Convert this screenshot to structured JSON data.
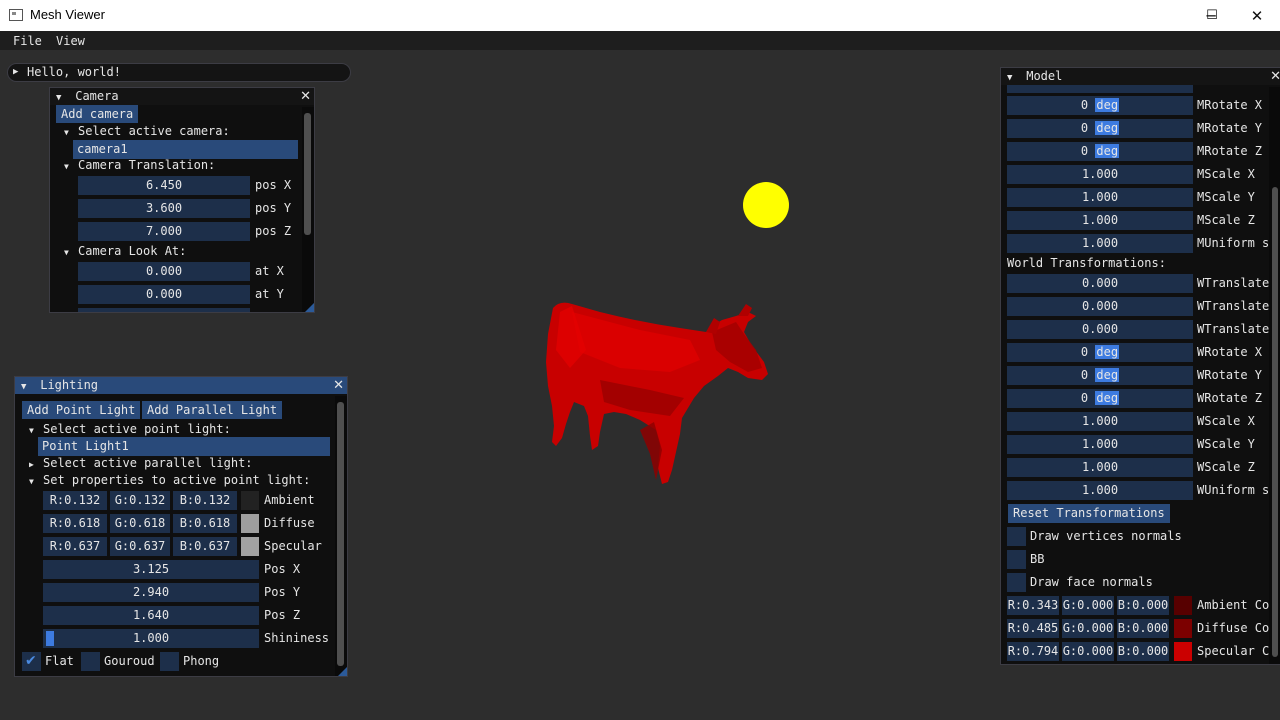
{
  "window": {
    "title": "Mesh Viewer",
    "minimize_glyph": "─",
    "maximize_glyph": "☐",
    "close_glyph": "✕"
  },
  "menu": {
    "file": "File",
    "view": "View"
  },
  "hello": {
    "label": "Hello, world!"
  },
  "camera": {
    "title": "Camera",
    "add_button": "Add camera",
    "select_label": "Select active camera:",
    "active_camera": "camera1",
    "translation_label": "Camera Translation:",
    "translation": [
      {
        "value": "6.450",
        "label": "pos X"
      },
      {
        "value": "3.600",
        "label": "pos Y"
      },
      {
        "value": "7.000",
        "label": "pos Z"
      }
    ],
    "lookat_label": "Camera Look At:",
    "lookat": [
      {
        "value": "0.000",
        "label": "at X"
      },
      {
        "value": "0.000",
        "label": "at Y"
      }
    ]
  },
  "lighting": {
    "title": "Lighting",
    "add_point": "Add Point Light",
    "add_parallel": "Add Parallel Light",
    "select_point_label": "Select active point light:",
    "active_point_light": "Point Light1",
    "select_parallel_label": "Select active parallel light:",
    "set_props_label": "Set properties to active point light:",
    "colors": [
      {
        "r": "R:0.132",
        "g": "G:0.132",
        "b": "B:0.132",
        "label": "Ambient",
        "swatch": "#222222"
      },
      {
        "r": "R:0.618",
        "g": "G:0.618",
        "b": "B:0.618",
        "label": "Diffuse",
        "swatch": "#9e9e9e"
      },
      {
        "r": "R:0.637",
        "g": "G:0.637",
        "b": "B:0.637",
        "label": "Specular",
        "swatch": "#a2a2a2"
      }
    ],
    "params": [
      {
        "value": "3.125",
        "label": "Pos X"
      },
      {
        "value": "2.940",
        "label": "Pos Y"
      },
      {
        "value": "1.640",
        "label": "Pos Z"
      },
      {
        "value": "1.000",
        "label": "Shininess"
      }
    ],
    "shading": {
      "flat": "Flat",
      "gouraud": "Gouroud",
      "phong": "Phong",
      "flat_checked": true
    }
  },
  "model": {
    "title": "Model",
    "model_rows": [
      {
        "value": "0",
        "unit": "deg",
        "label": "MRotate X"
      },
      {
        "value": "0",
        "unit": "deg",
        "label": "MRotate Y"
      },
      {
        "value": "0",
        "unit": "deg",
        "label": "MRotate Z"
      },
      {
        "value": "1.000",
        "unit": "",
        "label": "MScale X"
      },
      {
        "value": "1.000",
        "unit": "",
        "label": "MScale Y"
      },
      {
        "value": "1.000",
        "unit": "",
        "label": "MScale Z"
      },
      {
        "value": "1.000",
        "unit": "",
        "label": "MUniform s"
      }
    ],
    "world_label": "World Transformations:",
    "world_rows": [
      {
        "value": "0.000",
        "unit": "",
        "label": "WTranslate"
      },
      {
        "value": "0.000",
        "unit": "",
        "label": "WTranslate"
      },
      {
        "value": "0.000",
        "unit": "",
        "label": "WTranslate"
      },
      {
        "value": "0",
        "unit": "deg",
        "label": "WRotate X"
      },
      {
        "value": "0",
        "unit": "deg",
        "label": "WRotate Y"
      },
      {
        "value": "0",
        "unit": "deg",
        "label": "WRotate Z"
      },
      {
        "value": "1.000",
        "unit": "",
        "label": "WScale X"
      },
      {
        "value": "1.000",
        "unit": "",
        "label": "WScale Y"
      },
      {
        "value": "1.000",
        "unit": "",
        "label": "WScale Z"
      },
      {
        "value": "1.000",
        "unit": "",
        "label": "WUniform s"
      }
    ],
    "reset_button": "Reset Transformations",
    "checks": [
      "Draw vertices normals",
      "BB",
      "Draw face normals"
    ],
    "colors": [
      {
        "r": "R:0.343",
        "g": "G:0.000",
        "b": "B:0.000",
        "label": "Ambient Co",
        "swatch": "#570000"
      },
      {
        "r": "R:0.485",
        "g": "G:0.000",
        "b": "B:0.000",
        "label": "Diffuse Co",
        "swatch": "#7c0000"
      },
      {
        "r": "R:0.794",
        "g": "G:0.000",
        "b": "B:0.000",
        "label": "Specular C",
        "swatch": "#cb0000"
      }
    ]
  },
  "scene": {
    "light_color": "#ffff00",
    "model_color": "#d40000"
  }
}
